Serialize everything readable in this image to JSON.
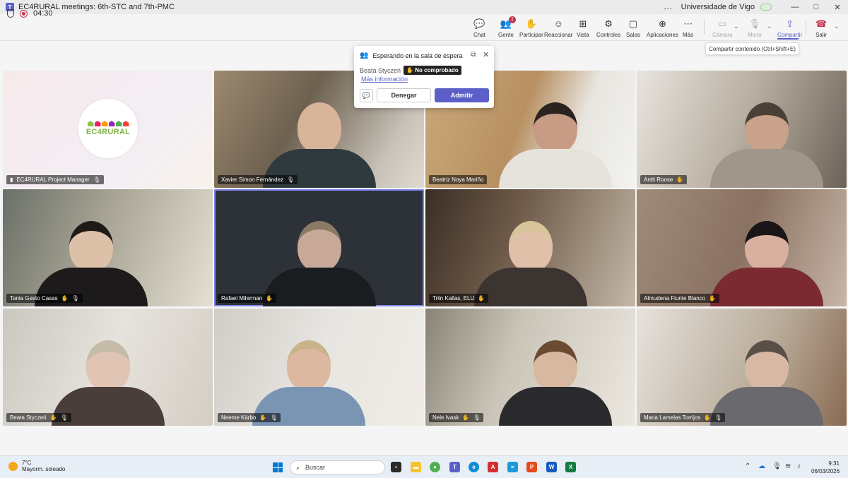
{
  "window": {
    "title": "EC4RURAL meetings: 6th-STC and 7th-PMC",
    "org": "Universidade de Vigo",
    "more": "...",
    "minimize": "—",
    "maximize": "□",
    "close": "✕"
  },
  "meeting": {
    "timer": "04:30",
    "toolbar": {
      "chat": "Chat",
      "people": "Gente",
      "people_badge": "1",
      "raise": "Participar",
      "react": "Reaccionar",
      "view": "Vista",
      "controls": "Controles",
      "rooms": "Salas",
      "apps": "Aplicaciones",
      "more": "Más",
      "camera": "Cámara",
      "mic": "Micro",
      "share": "Compartir",
      "leave": "Salir"
    },
    "tooltip": "Compartir contenido (Ctrl+Shift+E)"
  },
  "lobby": {
    "title": "Esperando en la sala de espera",
    "person": "Beata Styczeń",
    "status": "No comprobado",
    "more_info": "Más información",
    "deny": "Denegar",
    "admit": "Admitir"
  },
  "participants": [
    {
      "name": "EC4RURAL Project Manager"
    },
    {
      "name": "Xavier Simon Fernández"
    },
    {
      "name": "Beatriz Noya Mariño"
    },
    {
      "name": "Antti Roose"
    },
    {
      "name": "Tania Gesto Casas"
    },
    {
      "name": "Rafael Milerman"
    },
    {
      "name": "Triin Kallas, ELU"
    },
    {
      "name": "Almudena Fiunte Blanco"
    },
    {
      "name": "Beata Styczeń"
    },
    {
      "name": "Neeme Kärbo"
    },
    {
      "name": "Nele Ivask"
    },
    {
      "name": "Maria Lamelas Torrijos"
    }
  ],
  "logo_text": "EC4RURAL",
  "taskbar": {
    "temp": "7°C",
    "weather": "Mayorm. soleado",
    "search": "Buscar",
    "time": "9:31",
    "date": "06/03/2026"
  },
  "colors": {
    "accent": "#5b5fc7",
    "leave": "#c4314b"
  }
}
